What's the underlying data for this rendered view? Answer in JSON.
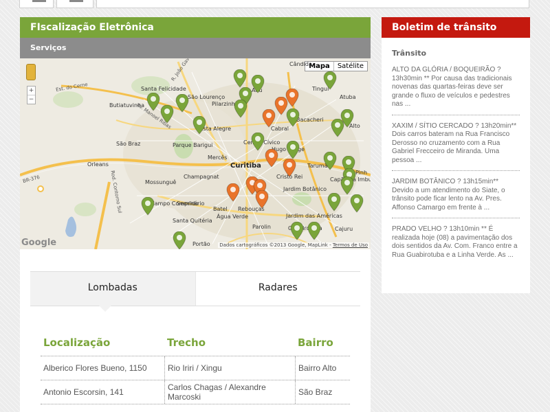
{
  "colors": {
    "accent_green": "#7aa53a",
    "accent_red": "#c4190f",
    "header_gray": "#8c8c8c",
    "pin_green": "#7aa53a",
    "pin_orange": "#e9742b"
  },
  "left_panel": {
    "title": "FIscalização Eletrônica",
    "subtitle": "Serviços"
  },
  "map": {
    "type_buttons": [
      "Mapa",
      "Satélite"
    ],
    "zoom_in": "+",
    "zoom_out": "−",
    "logo": "Google",
    "copyright": "Dados cartográficos ©2013 Google, MapLink -",
    "terms_link": "Termos de Uso",
    "labels": [
      "Cândida",
      "Santa Felicidade",
      "Butiatuvinha",
      "São Braz",
      "Orleans",
      "Mossunguê",
      "Campo Comprido",
      "Seminário",
      "Santa Quitéria",
      "Portão",
      "Vista Alegre",
      "Pilarzinho",
      "São Lourenço",
      "Parque Barigui",
      "Mercês",
      "Champagnat",
      "Batel",
      "Rebouças",
      "Centro Cívico",
      "Curitiba",
      "Hugo Lange",
      "Cristo Rei",
      "Jardim Botânico",
      "Água Verde",
      "Parolin",
      "Jardim das Américas",
      "Guabirotuba",
      "Cabral",
      "Ahú",
      "Bacacheri",
      "Tingui",
      "Atuba",
      "Tarumã",
      "Capão da Imbuia",
      "Cajuru",
      "Pinh",
      "Alto"
    ],
    "roads": [
      "R. João Gava",
      "Est. do Cerne",
      "Av. Manoel Ribas",
      "BR-376",
      "Rod. Contorno Sul"
    ],
    "pins": {
      "lombadas_green": 24,
      "radares_orange": 9
    }
  },
  "tabs": [
    "Lombadas",
    "Radares"
  ],
  "table": {
    "headers": [
      "Localização",
      "Trecho",
      "Bairro"
    ],
    "rows": [
      [
        "Alberico Flores Bueno, 1150",
        "Rio Iriri / Xingu",
        "Bairro Alto"
      ],
      [
        "Antonio Escorsin, 141",
        "Carlos Chagas / Alexandre Marcoski",
        "São Braz"
      ]
    ]
  },
  "right_panel": {
    "title": "Boletim de trânsito",
    "section": "Trânsito",
    "news": [
      "ALTO DA GLÓRIA / BOQUEIRÃO ? 13h30min ** Por causa das tradicionais novenas das quartas-feiras deve ser grande o fluxo de veículos e pedestres nas ...",
      "XAXIM / SÍTIO CERCADO ? 13h20min** Dois carros bateram na Rua Francisco Derosso no cruzamento com a Rua Gabriel Frecceiro de Miranda. Uma pessoa ...",
      "JARDIM BOTÂNICO ? 13h15min** Devido a um atendimento do Siate, o trânsito pode ficar lento na Av. Pres. Affonso Camargo em frente à ...",
      "PRADO VELHO ? 13h10min ** É realizada hoje (08) a pavimentação dos dois sentidos da Av. Com. Franco entre a Rua Guabirotuba e a Linha Verde. As ..."
    ]
  }
}
